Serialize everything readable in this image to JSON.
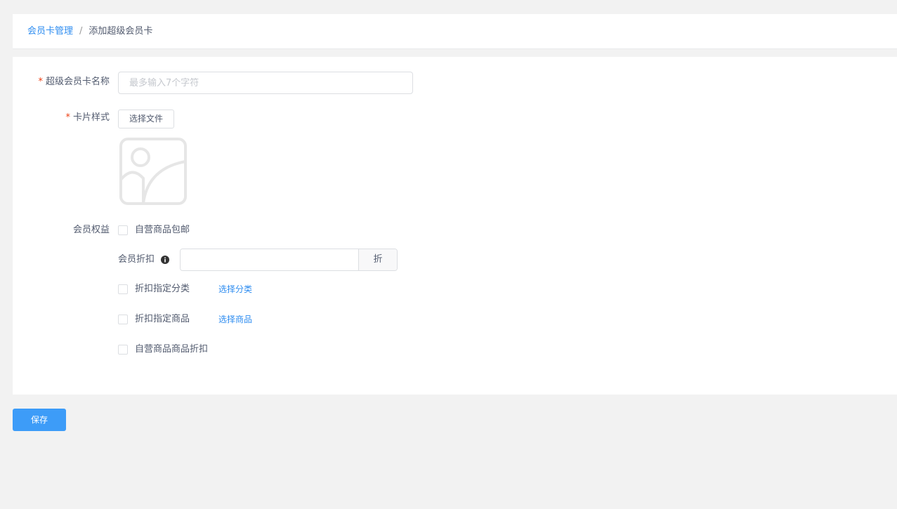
{
  "breadcrumb": {
    "parent": "会员卡管理",
    "separator": "/",
    "current": "添加超级会员卡"
  },
  "form": {
    "name": {
      "required_mark": "*",
      "label": "超级会员卡名称",
      "placeholder": "最多输入7个字符",
      "value": ""
    },
    "card_style": {
      "required_mark": "*",
      "label": "卡片样式",
      "button_label": "选择文件"
    },
    "benefits": {
      "label": "会员权益",
      "free_shipping_label": "自营商品包邮",
      "discount_label": "会员折扣",
      "discount_value": "",
      "discount_unit": "折",
      "category_discount_label": "折扣指定分类",
      "select_category_link": "选择分类",
      "product_discount_label": "折扣指定商品",
      "select_product_link": "选择商品",
      "own_product_discount_label": "自营商品商品折扣"
    }
  },
  "footer": {
    "save_label": "保存"
  },
  "colors": {
    "accent": "#2d8cf0",
    "save_button": "#3d9cf8",
    "required": "#ed4014"
  },
  "icons": [
    "image-placeholder-icon",
    "info-icon"
  ]
}
